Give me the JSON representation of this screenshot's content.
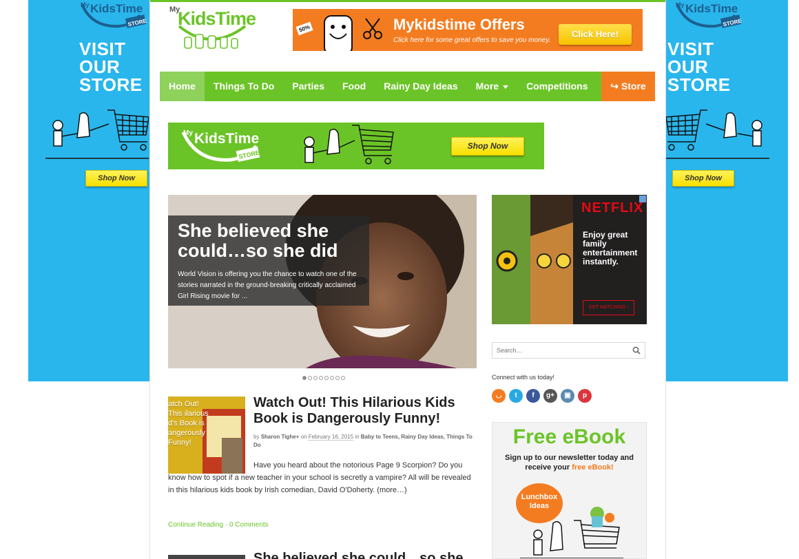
{
  "skins": {
    "logo_my": "My",
    "logo_kids": "KidsTime",
    "logo_store": "STORE",
    "visit_lines": [
      "VISIT",
      "OUR",
      "STORE"
    ],
    "shop_now": "Shop Now",
    "color": "#29b6ec"
  },
  "header": {
    "logo_my": "My",
    "logo_kids": "KidsTime",
    "offers_title": "Mykidstime Offers",
    "offers_sub": "Click here for some great offers to save you money.",
    "offers_click": "Click Here!",
    "offers_badge": "50%"
  },
  "nav": {
    "items": [
      {
        "label": "Home"
      },
      {
        "label": "Things To Do"
      },
      {
        "label": "Parties"
      },
      {
        "label": "Food"
      },
      {
        "label": "Rainy Day Ideas"
      },
      {
        "label": "More"
      },
      {
        "label": "Competitions"
      }
    ],
    "store": "↪ Store"
  },
  "store_banner": {
    "logo_my": "My",
    "logo_kids": "KidsTime",
    "logo_store": "STORE",
    "shop_now": "Shop Now"
  },
  "slider": {
    "title": "She believed she could…so she did",
    "text": "World Vision is offering you the chance to watch one of the stories narrated in the ground-breaking critically acclaimed Girl Rising movie for ...",
    "dots_total": 8,
    "dots_active": 1
  },
  "post": {
    "thumb_text": "atch Out! This ilarious d's Book is angerously Funny!",
    "title": "Watch Out! This Hilarious Kids Book is Dangerously Funny!",
    "meta_by": "by",
    "author": "Sharon Tighe+",
    "meta_on": "on",
    "date": "February 16, 2015",
    "meta_in": "in",
    "categories": "Baby to Teens, Rainy Day Ideas, Things To Do",
    "body": "Have you heard about the notorious Page 9 Scorpion? Do you know how to spot if a new teacher in your school is secretly a vampire? All will be revealed in this hilarious kids book by Irish comedian, David O'Doherty. (more…)",
    "continue": "Continue Reading",
    "separator": "·",
    "comments": "0 Comments"
  },
  "post2": {
    "title": "She believed she could…so she"
  },
  "sidebar": {
    "netflix_logo": "NETFLIX",
    "netflix_text": "Enjoy great family entertainment instantly.",
    "netflix_btn": "GET WATCHING ›",
    "search_placeholder": "Search…",
    "connect": "Connect with us today!",
    "socials": [
      {
        "icon": "rss-icon",
        "glyph": "◡",
        "color": "#f47c20"
      },
      {
        "icon": "twitter-icon",
        "glyph": "t",
        "color": "#29a9e1"
      },
      {
        "icon": "facebook-icon",
        "glyph": "f",
        "color": "#3b5998"
      },
      {
        "icon": "google-plus-icon",
        "glyph": "g+",
        "color": "#555555"
      },
      {
        "icon": "instagram-icon",
        "glyph": "▣",
        "color": "#5b8bb0"
      },
      {
        "icon": "pinterest-icon",
        "glyph": "p",
        "color": "#d9363e"
      }
    ],
    "ebook_title": "Free eBook",
    "ebook_line1": "Sign up to our newsletter today and",
    "ebook_line2a": "receive your ",
    "ebook_line2b": "free eBook!",
    "ebook_badge": "Lunchbox Ideas"
  },
  "colors": {
    "brand_green": "#6bc427",
    "brand_orange": "#f47c20",
    "skin_blue": "#29b6ec"
  }
}
